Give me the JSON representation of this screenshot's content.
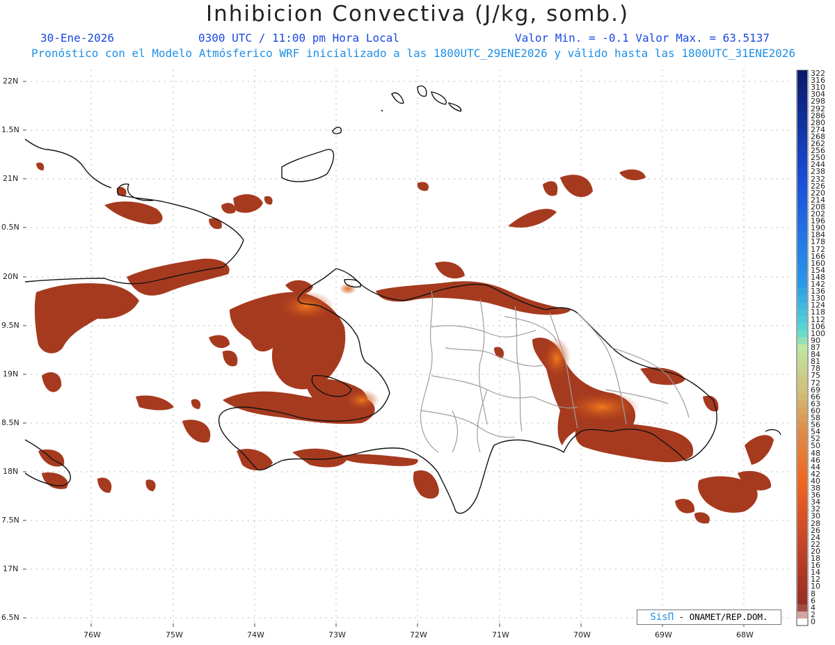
{
  "title": "Inhibicion Convectiva (J/kg, somb.)",
  "header": {
    "date": "30-Ene-2026",
    "time": "0300 UTC / 11:00 pm Hora Local",
    "value_range": "Valor Min. = -0.1  Valor Max. = 63.5137",
    "forecast_info": "Pronóstico con el Modelo Atmósferico WRF inicializado a las 1800UTC_29ENE2026 y válido hasta las  1800UTC_31ENE2026"
  },
  "map": {
    "lat_labels": [
      "22N",
      "1.5N",
      "21N",
      "0.5N",
      "20N",
      "9.5N",
      "19N",
      "8.5N",
      "18N",
      "7.5N",
      "17N",
      "6.5N"
    ],
    "lon_labels": [
      "76W",
      "75W",
      "74W",
      "73W",
      "72W",
      "71W",
      "70W",
      "69W",
      "68W"
    ],
    "region": "Hispaniola"
  },
  "colorbar": {
    "labels": [
      "322",
      "316",
      "310",
      "304",
      "298",
      "292",
      "286",
      "280",
      "274",
      "268",
      "262",
      "256",
      "250",
      "244",
      "238",
      "232",
      "226",
      "220",
      "214",
      "208",
      "202",
      "196",
      "190",
      "184",
      "178",
      "172",
      "166",
      "160",
      "154",
      "148",
      "142",
      "136",
      "130",
      "124",
      "118",
      "112",
      "106",
      "100",
      "90",
      "87",
      "84",
      "81",
      "78",
      "75",
      "72",
      "69",
      "66",
      "63",
      "60",
      "58",
      "56",
      "54",
      "52",
      "50",
      "48",
      "46",
      "44",
      "42",
      "40",
      "38",
      "36",
      "34",
      "32",
      "30",
      "28",
      "26",
      "24",
      "22",
      "20",
      "18",
      "16",
      "14",
      "12",
      "10",
      "8",
      "6",
      "4",
      "2",
      "0"
    ]
  },
  "credit": {
    "logo": "SisΠ",
    "text": " - ONAMET/REP.DOM."
  }
}
